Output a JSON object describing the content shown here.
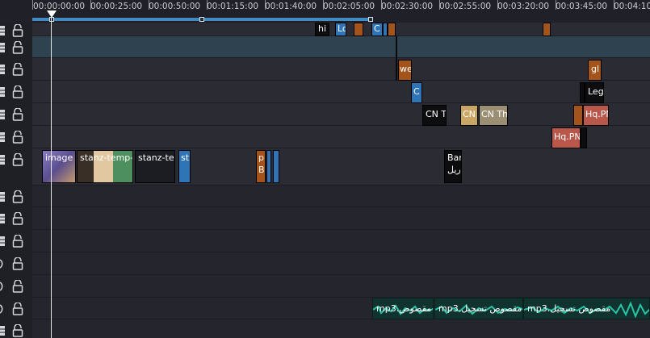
{
  "ruler": {
    "ticks": [
      "00:00:00:00",
      "00:00:25:00",
      "00:00:50:00",
      "00:01:15:00",
      "00:01:40:00",
      "00:02:05:00",
      "00:02:30:00",
      "00:02:55:00",
      "00:03:20:00",
      "00:03:45:00",
      "00:04:10"
    ]
  },
  "clips": {
    "c1": "hi",
    "c2": "Lo",
    "c3": "",
    "c4": "C",
    "c5": "we",
    "c6": "gl",
    "c7": "C",
    "c8": "Leg",
    "c9": "CN T",
    "c10": "CN",
    "c11": "CN Th",
    "c12": "Hq.PN",
    "c13": "Hq.PN",
    "c14": "image",
    "c15": "stanz-temp-",
    "c16": "stanz-ter",
    "c17": "st",
    "c18": "p",
    "c18b": "B",
    "c19": "Bar",
    "c19b": "ريل",
    "a1": "mp3.مقصوص",
    "a2": "mp3.مقصوص تسجيل",
    "a3": "mp3.مقصوص تسجيل"
  },
  "colors": {
    "selected_track": "#2f4250",
    "orange_clip": "#a4541a",
    "blue_clip": "#2f74b7",
    "audio_wave": "#2bc4a6",
    "ruler_bar": "#3f8bc2"
  }
}
